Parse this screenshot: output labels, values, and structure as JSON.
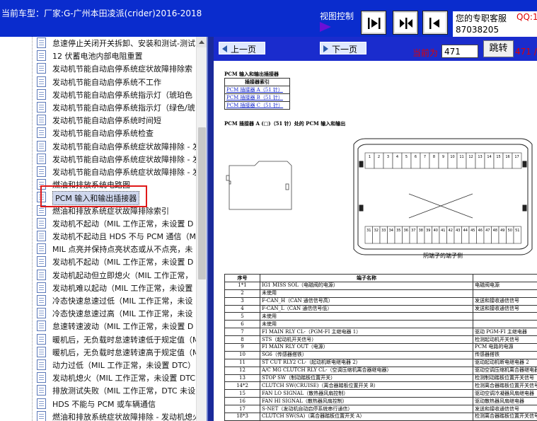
{
  "topbar": {
    "car_model": "当前车型：厂家:G-广州本田凌派(crider)2016-2018",
    "view_control_label": "视图控制",
    "service_label": "您的专职客服",
    "service_qq": "QQ:1",
    "service_number": "87038205"
  },
  "tree": {
    "selected_index": 12,
    "items": [
      "怠速停止关闭开关拆卸、安装和测试-测试",
      "12 伏蓄电池内部电阻重置",
      "发动机节能自动启停系统症状故障排除索",
      "发动机节能自动启停系统不工作",
      "发动机节能自动启停系统指示灯（琥珀色",
      "发动机节能自动启停系统指示灯（绿色/琥",
      "发动机节能自动启停系统时间短",
      "发动机节能自动启停系统检查",
      "发动机节能自动启停系统症状故障排除 - 发",
      "发动机节能自动启停系统症状故障排除 - 发",
      "发动机节能自动启停系统症状故障排除 - 发",
      "燃油和排放系统电路图",
      "PCM 输入和输出插接器",
      "燃油和排放系统症状故障排除索引",
      "发动机不起动（MIL 工作正常，未设置 D",
      "发动机不起动且 HDS 不与 PCM 通信（M",
      "MIL 点亮并保持点亮状态或从不点亮，未",
      "发动机不起动（MIL 工作正常，未设置 D",
      "发动机起动但立即熄火（MIL 工作正常，",
      "发动机难以起动（MIL 工作正常，未设置",
      "冷态快速怠速过低（MIL 工作正常，未设",
      "冷态快速怠速过高（MIL 工作正常，未设",
      "怠速转速波动（MIL 工作正常，未设置 D",
      "暖机后，无负载时怠速转速低于规定值（M",
      "暖机后，无负载时怠速转速高于规定值（M",
      "动力过低（MIL 工作正常，未设置 DTC）",
      "发动机熄火（MIL 工作正常，未设置 DTC",
      "排放测试失败（MIL 工作正常，DTC 未设",
      "HDS 不能与 PCM 或车辆通信",
      "燃油和排放系统症状故障排除 - 发动机熄火"
    ]
  },
  "navigation": {
    "prev_label": "上一页",
    "next_label": "下一页",
    "current_label": "当前为",
    "current_page": "471",
    "jump_label": "跳转",
    "total_pages": "471 /"
  },
  "document": {
    "heading": "PCM 输入和输出插接器",
    "index_title": "插接器索引",
    "index_links": [
      "PCM 插接器 A（51 针）",
      "PCM 插接器 B（51 针）",
      "PCM 插接器 C（51 针）"
    ],
    "connector_title": "PCM 插接器 A (□)（51 针）处的 PCM 输入和输出",
    "diagram_caption": "阴端子的端子侧",
    "pin_rows_top": [
      "1",
      "2",
      "3",
      "4",
      "5",
      "6",
      "7",
      "8",
      "9",
      "10",
      "11",
      "12",
      "13",
      "14",
      "15",
      "16",
      "17"
    ],
    "pin_rows_bottom": [
      "31",
      "32",
      "33",
      "34",
      "35",
      "36",
      "37",
      "38",
      "39",
      "40",
      "41",
      "42",
      "43",
      "44",
      "45",
      "46",
      "47",
      "48",
      "49",
      "50",
      "51"
    ],
    "pin_table": {
      "headers": [
        "序号",
        "端子名称",
        ""
      ],
      "rows": [
        [
          "1*1",
          "IG1 MISS SOL（电磁阀的电源）",
          "电磁阀电源"
        ],
        [
          "2",
          "未使用",
          ""
        ],
        [
          "3",
          "F-CAN_H（CAN 通信信号高）",
          "发送和接收通信信号"
        ],
        [
          "4",
          "F-CAN_L（CAN 通信信号低）",
          "发送和接收通信信号"
        ],
        [
          "5",
          "未使用",
          ""
        ],
        [
          "6",
          "未使用",
          ""
        ],
        [
          "7",
          "FI MAIN RLY CL-（PGM-FI 主继电器 1）",
          "驱动 PGM-FI 主继电器"
        ],
        [
          "8",
          "STS（起动机开关信号）",
          "检测起动机开关信号"
        ],
        [
          "9",
          "FI MAIN RLY OUT（电源）",
          "PCM 电路的电源"
        ],
        [
          "10",
          "SG6（传感器搭铁）",
          "传感器搭铁"
        ],
        [
          "11",
          "ST CUT RLY2 CL-（起动机断电继电器 2）",
          "驱动起动机断电继电器 2"
        ],
        [
          "12",
          "A/C MG CLUTCH RLY CL-（空调压缩机离合器继电器）",
          "驱动空调压缩机离合器继电器"
        ],
        [
          "13",
          "STOP SW（制动踏板位置开关）",
          "检测制动踏板位置开关信号"
        ],
        [
          "14*2",
          "CLUTCH SW(CRUISE)（离合器踏板位置开关 B）",
          "检测离合器踏板位置开关信号"
        ],
        [
          "15",
          "FAN LO SIGNAL（散热器风扇控制）",
          "驱动空调冷凝器风扇继电器"
        ],
        [
          "16",
          "FAN HI SIGNAL（散热器风扇控制）",
          "驱动散热器风扇继电器"
        ],
        [
          "17",
          "S-NET（发动机自动启停系统串行通信）",
          "发送和接收通信信号"
        ],
        [
          "18*3",
          "CLUTCH SW(SA)（离合器踏板位置开关 A）",
          "检测离合器踏板位置开关信号"
        ]
      ]
    }
  },
  "colors": {
    "topbar_bg": "#0a2ccd",
    "highlight_box": "#e01818",
    "page_text_red": "#e00000"
  }
}
